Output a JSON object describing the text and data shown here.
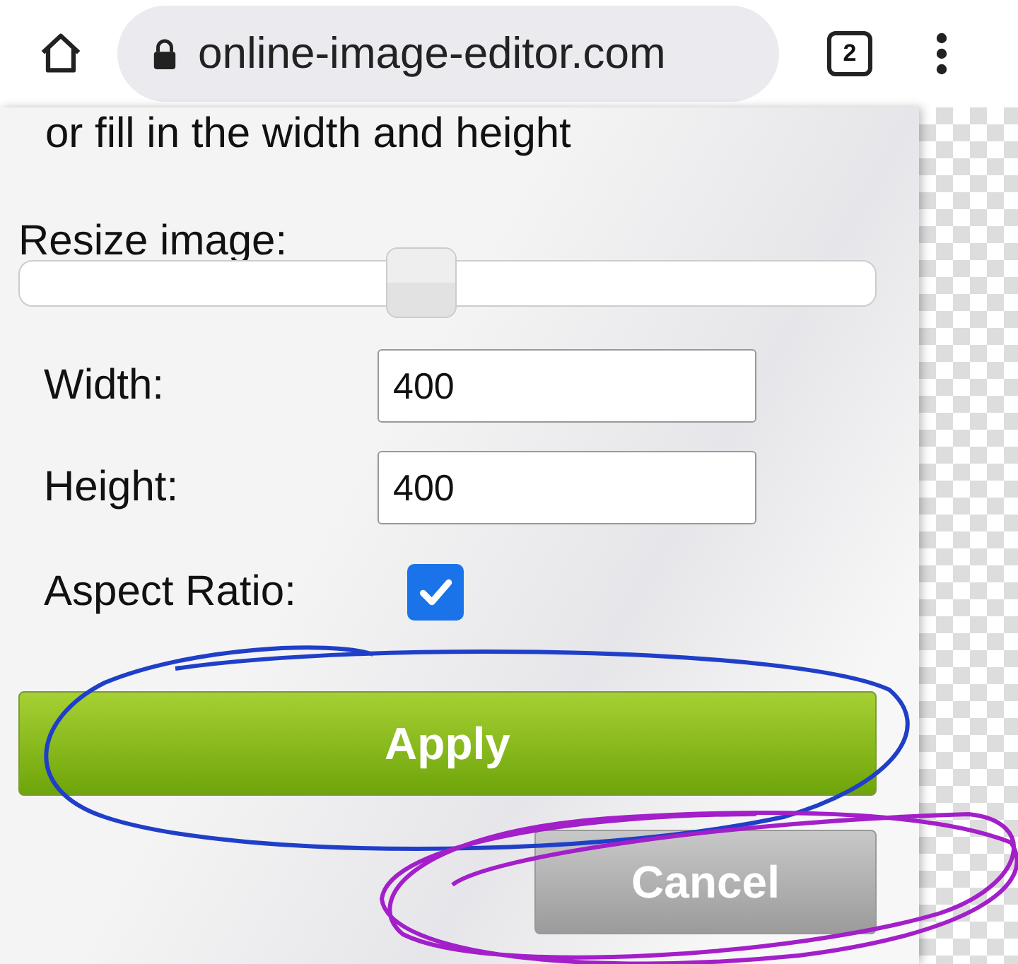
{
  "browser": {
    "url": "online-image-editor.com",
    "tab_count": "2"
  },
  "intro_text": "or fill in the width and height",
  "resize": {
    "label": "Resize image:",
    "level": 0.47
  },
  "fields": [
    {
      "label": "Width:",
      "value": "400"
    },
    {
      "label": "Height:",
      "value": "400"
    }
  ],
  "aspect_ratio": {
    "label": "Aspect Ratio:",
    "checked": true
  },
  "buttons": [
    {
      "label": "Apply",
      "kind": "primary"
    },
    {
      "label": "Cancel",
      "kind": "secondary"
    }
  ]
}
